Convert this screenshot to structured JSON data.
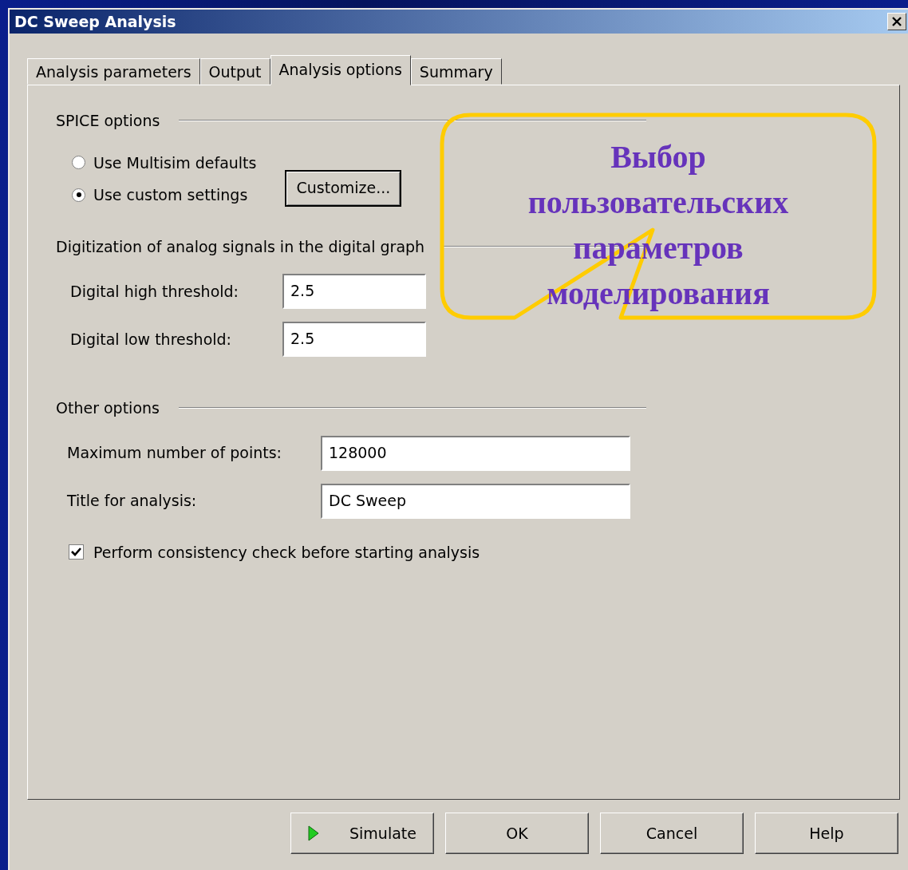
{
  "window": {
    "title": "DC Sweep Analysis"
  },
  "tabs": [
    {
      "label": "Analysis parameters",
      "selected": false
    },
    {
      "label": "Output",
      "selected": false
    },
    {
      "label": "Analysis options",
      "selected": true
    },
    {
      "label": "Summary",
      "selected": false
    }
  ],
  "spice_options": {
    "heading": "SPICE options",
    "radios": [
      {
        "label": "Use Multisim defaults",
        "selected": false
      },
      {
        "label": "Use custom settings",
        "selected": true
      }
    ],
    "customize_button": "Customize..."
  },
  "digitization": {
    "heading": "Digitization of analog signals in the digital graph",
    "fields": [
      {
        "label": "Digital high threshold:",
        "value": "2.5"
      },
      {
        "label": "Digital low threshold:",
        "value": "2.5"
      }
    ]
  },
  "other_options": {
    "heading": "Other options",
    "fields": [
      {
        "label": "Maximum number of points:",
        "value": "128000"
      },
      {
        "label": "Title for analysis:",
        "value": "DC Sweep"
      }
    ],
    "checkbox": {
      "label": "Perform consistency check before starting analysis",
      "checked": true
    }
  },
  "callout": {
    "text": "Выбор пользовательских параметров моделирования"
  },
  "buttons": [
    {
      "label": "Simulate",
      "kind": "simulate"
    },
    {
      "label": "OK",
      "kind": "plain"
    },
    {
      "label": "Cancel",
      "kind": "plain"
    },
    {
      "label": "Help",
      "kind": "plain"
    }
  ]
}
